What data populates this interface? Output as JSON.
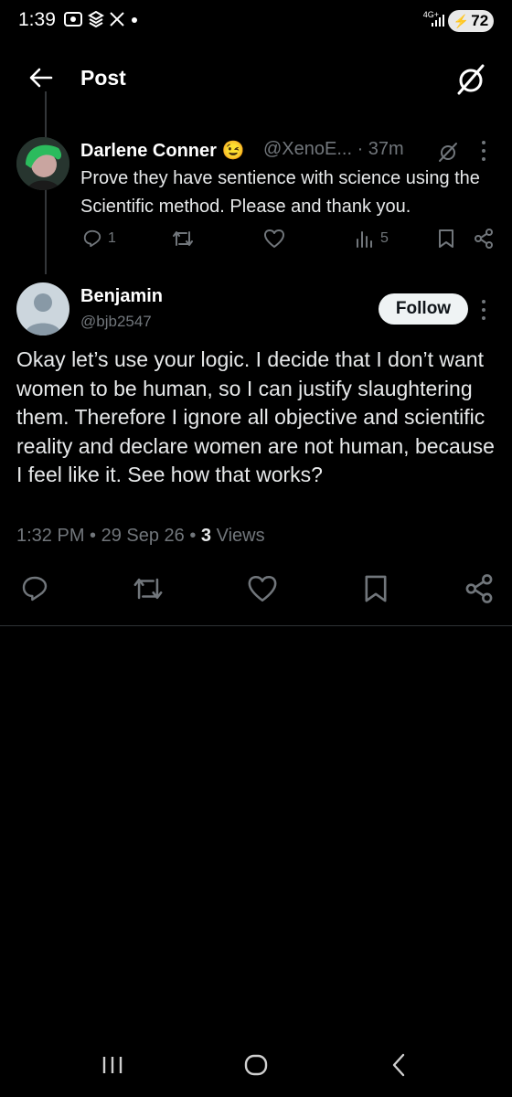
{
  "status_bar": {
    "time": "1:39",
    "network": "4G+",
    "battery": "72"
  },
  "header": {
    "title": "Post"
  },
  "parent_tweet": {
    "name": "Darlene Conner 😉",
    "handle_time": "@XenoE... · 37m",
    "text": "Prove they have sentience with science using the Scientific method. Please and thank you.",
    "replies": "1",
    "views": "5"
  },
  "reply_tweet": {
    "name": "Benjamin",
    "handle": "@bjb2547",
    "follow_label": "Follow",
    "text": "Okay let’s use your logic. I decide that I don’t want women to be human, so I can justify slaughtering them. Therefore I ignore all objective and scientific reality and declare women are not human, because I feel like it. See how that works?",
    "timestamp": "1:32 PM • 29 Sep 26 • ",
    "views_count": "3",
    "views_label": " Views"
  },
  "colors": {
    "background": "#000000",
    "text": "#e7e9ea",
    "muted": "#71767b",
    "divider": "#2f3336"
  }
}
